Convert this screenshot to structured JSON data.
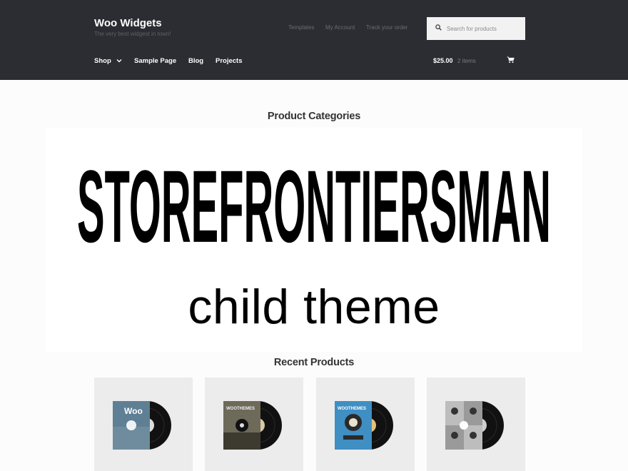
{
  "header": {
    "site_title": "Woo Widgets",
    "site_description": "The very best widgest in town!",
    "secondary_nav": [
      "Templates",
      "My Account",
      "Track your order"
    ],
    "search": {
      "placeholder": "Search for products",
      "value": ""
    },
    "primary_nav": [
      "Shop",
      "Sample Page",
      "Blog",
      "Projects"
    ],
    "cart": {
      "total": "$25.00",
      "count": "2 items"
    }
  },
  "categories_section": {
    "title": "Product Categories"
  },
  "banner": {
    "title": "STOREFRONTIERSMAN",
    "subtitle": "child theme"
  },
  "recent_section": {
    "title": "Recent Products"
  },
  "products": [
    {
      "label": "Woo",
      "sleeve_color": "#5f7f94",
      "icon": "vinyl-record-woo"
    },
    {
      "label": "WOOTHEMES",
      "sleeve_color": "#6e6a5a",
      "icon": "vinyl-record-woothemes-dark"
    },
    {
      "label": "WOOTHEMES",
      "sleeve_color": "#3f8fc3",
      "icon": "vinyl-record-woothemes-blue"
    },
    {
      "label": "",
      "sleeve_color": "#9a9a9a",
      "icon": "vinyl-record-ninjas"
    }
  ],
  "colors": {
    "header_bg": "#2c2d33",
    "page_bg": "#fcfcfc",
    "product_bg": "#ececec"
  }
}
